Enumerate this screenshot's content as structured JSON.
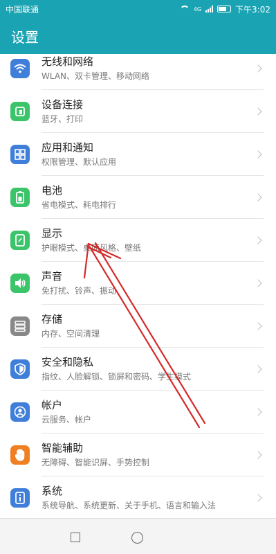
{
  "status_bar": {
    "carrier": "中国联通",
    "signal_text": "4G",
    "time": "下午3:02"
  },
  "app_bar": {
    "title": "设置"
  },
  "items": [
    {
      "title": "无线和网络",
      "subtitle": "WLAN、双卡管理、移动网络",
      "icon": "wifi-icon",
      "color": "#3f7fd9"
    },
    {
      "title": "设备连接",
      "subtitle": "蓝牙、打印",
      "icon": "device-connect-icon",
      "color": "#3cc46a"
    },
    {
      "title": "应用和通知",
      "subtitle": "权限管理、默认应用",
      "icon": "apps-grid-icon",
      "color": "#3f7fd9"
    },
    {
      "title": "电池",
      "subtitle": "省电模式、耗电排行",
      "icon": "battery-icon",
      "color": "#3cc46a"
    },
    {
      "title": "显示",
      "subtitle": "护眼模式、桌面风格、壁纸",
      "icon": "display-icon",
      "color": "#3cc46a"
    },
    {
      "title": "声音",
      "subtitle": "免打扰、铃声、振动",
      "icon": "speaker-icon",
      "color": "#3cc46a"
    },
    {
      "title": "存储",
      "subtitle": "内存、空间清理",
      "icon": "storage-icon",
      "color": "#888888"
    },
    {
      "title": "安全和隐私",
      "subtitle": "指纹、人脸解锁、锁屏和密码、学生模式",
      "icon": "shield-icon",
      "color": "#3f7fd9"
    },
    {
      "title": "帐户",
      "subtitle": "云服务、帐户",
      "icon": "account-icon",
      "color": "#3f7fd9"
    },
    {
      "title": "智能辅助",
      "subtitle": "无障碍、智能识屏、手势控制",
      "icon": "hand-icon",
      "color": "#f07f22"
    },
    {
      "title": "系统",
      "subtitle": "系统导航、系统更新、关于手机、语言和输入法",
      "icon": "system-icon",
      "color": "#3f7fd9"
    }
  ],
  "annotation": {
    "color": "#d42a2a"
  }
}
